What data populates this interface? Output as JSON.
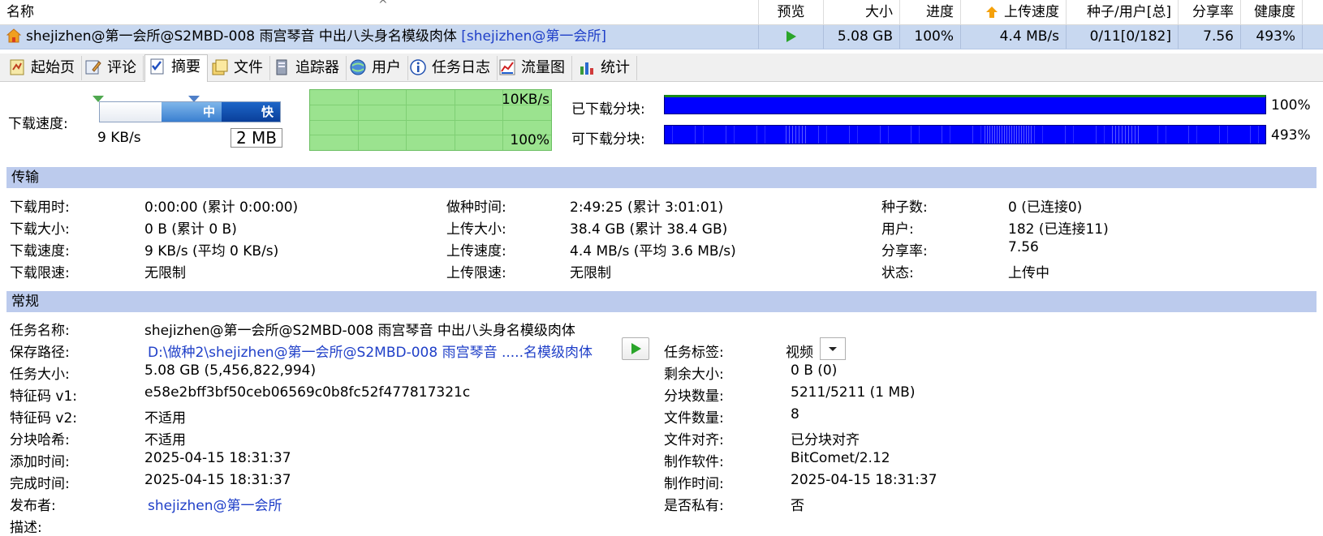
{
  "columns": {
    "name": "名称",
    "preview": "预览",
    "size": "大小",
    "progress": "进度",
    "up_speed": "上传速度",
    "seeds_peers": "种子/用户[总]",
    "ratio": "分享率",
    "health": "健康度"
  },
  "torrent": {
    "name": "shejizhen@第一会所@S2MBD-008 雨宫琴音 中出八头身名模级肉体",
    "tag": "[shejizhen@第一会所]",
    "size": "5.08 GB",
    "progress": "100%",
    "up_speed": "4.4 MB/s",
    "seeds_peers": "0/11[0/182]",
    "ratio": "7.56",
    "health": "493%"
  },
  "tabs": [
    "起始页",
    "评论",
    "摘要",
    "文件",
    "追踪器",
    "用户",
    "任务日志",
    "流量图",
    "统计"
  ],
  "speed_widget": {
    "label": "下载速度:",
    "mid_label": "中",
    "fast_label": "快",
    "current": "9 KB/s",
    "cache": "2 MB"
  },
  "mini_graph": {
    "scale": "10KB/s",
    "percent": "100%"
  },
  "pieces": {
    "downloaded_label": "已下载分块:",
    "downloaded_value": "100%",
    "available_label": "可下载分块:",
    "available_value": "493%"
  },
  "transfer": {
    "section_title": "传输",
    "rows": [
      [
        "下载用时:",
        "0:00:00 (累计 0:00:00)",
        "做种时间:",
        "2:49:25 (累计 3:01:01)",
        "种子数:",
        "0 (已连接0)"
      ],
      [
        "下载大小:",
        "0 B (累计 0 B)",
        "上传大小:",
        "38.4 GB (累计 38.4 GB)",
        "用户:",
        "182 (已连接11)"
      ],
      [
        "下载速度:",
        "9 KB/s (平均 0 KB/s)",
        "上传速度:",
        "4.4 MB/s (平均 3.6 MB/s)",
        "分享率:",
        "7.56"
      ],
      [
        "下载限速:",
        "无限制",
        "上传限速:",
        "无限制",
        "状态:",
        "上传中"
      ]
    ]
  },
  "general": {
    "section_title": "常规",
    "task_name_label": "任务名称:",
    "task_name": "shejizhen@第一会所@S2MBD-008 雨宫琴音 中出八头身名模级肉体",
    "save_path_label": "保存路径:",
    "save_path": "D:\\做种2\\shejizhen@第一会所@S2MBD-008 雨宫琴音 .....名模级肉体",
    "task_tag_label": "任务标签:",
    "task_tag": "视频",
    "left_rows": [
      [
        "任务大小:",
        "5.08 GB (5,456,822,994)"
      ],
      [
        "特征码 v1:",
        "e58e2bff3bf50ceb06569c0b8fc52f477817321c"
      ],
      [
        "特征码 v2:",
        "不适用"
      ],
      [
        "分块哈希:",
        "不适用"
      ],
      [
        "添加时间:",
        "2025-04-15 18:31:37"
      ],
      [
        "完成时间:",
        "2025-04-15 18:31:37"
      ],
      [
        "发布者:",
        "shejizhen@第一会所"
      ],
      [
        "描述:",
        ""
      ]
    ],
    "right_rows": [
      [
        "剩余大小:",
        "0 B (0)"
      ],
      [
        "分块数量:",
        "5211/5211 (1 MB)"
      ],
      [
        "文件数量:",
        "8"
      ],
      [
        "文件对齐:",
        "已分块对齐"
      ],
      [
        "制作软件:",
        "BitComet/2.12"
      ],
      [
        "制作时间:",
        "2025-04-15 18:31:37"
      ],
      [
        "是否私有:",
        "否"
      ]
    ]
  },
  "colors": {
    "selected_row": "#c8d8f0",
    "section_bar": "#bccbed",
    "piece_bar": "#0000ff",
    "graph_bg": "#9be38f",
    "link": "#1f3fc8"
  }
}
